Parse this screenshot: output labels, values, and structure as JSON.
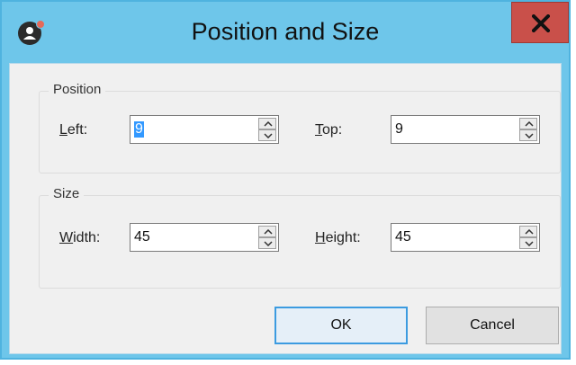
{
  "window": {
    "title": "Position and Size",
    "close_icon": "close-icon",
    "app_icon": "user-icon"
  },
  "position": {
    "legend": "Position",
    "left": {
      "label_accel": "L",
      "label_rest": "eft:",
      "value": "9"
    },
    "top": {
      "label_accel": "T",
      "label_rest": "op:",
      "value": "9"
    }
  },
  "size": {
    "legend": "Size",
    "width": {
      "label_accel": "W",
      "label_rest": "idth:",
      "value": "45"
    },
    "height": {
      "label_accel": "H",
      "label_rest": "eight:",
      "value": "45"
    }
  },
  "buttons": {
    "ok_label": "OK",
    "cancel_label": "Cancel"
  },
  "colors": {
    "titlebar": "#6ec6ea",
    "close_button": "#c9504a",
    "selection": "#3399ff",
    "default_button_border": "#3c9be0"
  }
}
